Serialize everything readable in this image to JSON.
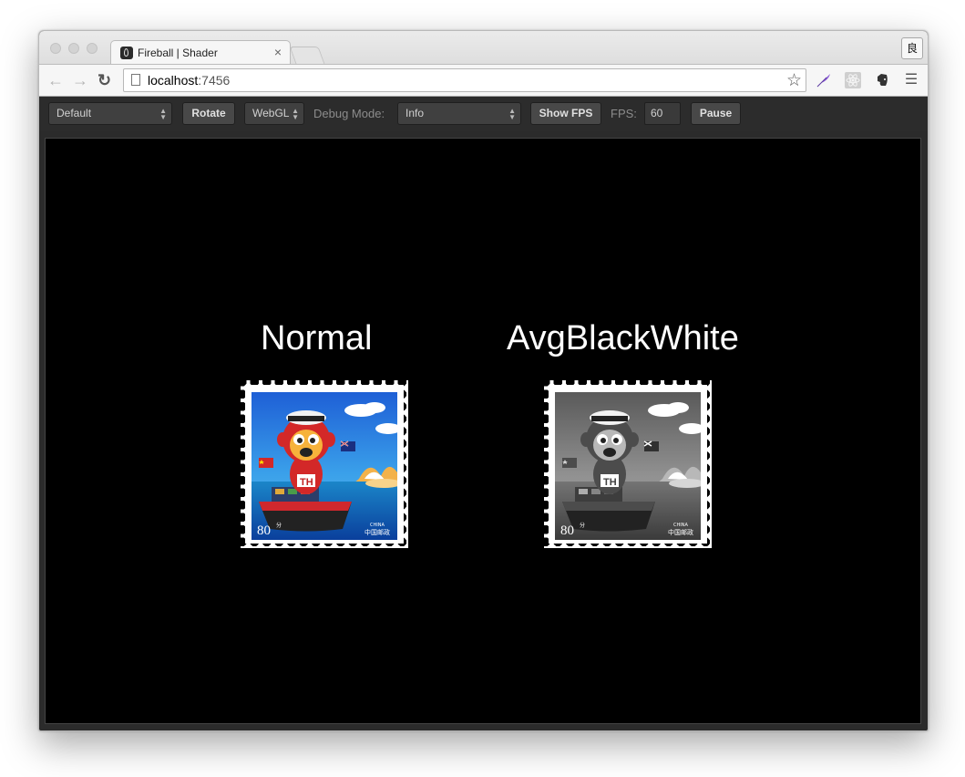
{
  "browser": {
    "tab_title": "Fireball | Shader",
    "tab_close": "×",
    "profile_glyph": "良",
    "url_host": "localhost",
    "url_port": ":7456",
    "icons": [
      "back-arrow-icon",
      "forward-arrow-icon",
      "reload-icon",
      "page-icon",
      "star-icon",
      "feather-extension-icon",
      "react-extension-icon",
      "evernote-extension-icon",
      "menu-icon"
    ]
  },
  "toolbar": {
    "scene_select": "Default",
    "rotate_label": "Rotate",
    "renderer_select": "WebGL",
    "debug_mode_label": "Debug Mode:",
    "debug_mode_select": "Info",
    "show_fps_label": "Show FPS",
    "fps_label": "FPS:",
    "fps_value": "60",
    "pause_label": "Pause"
  },
  "canvas": {
    "background": "#000000",
    "samples": [
      {
        "caption": "Normal",
        "stamp_value": "80",
        "stamp_unit": "分",
        "stamp_country": "中国邮政",
        "stamp_en": "CHINA",
        "filter": "none"
      },
      {
        "caption": "AvgBlackWhite",
        "stamp_value": "80",
        "stamp_unit": "分",
        "stamp_country": "中国邮政",
        "stamp_en": "CHINA",
        "filter": "grayscale"
      }
    ]
  }
}
